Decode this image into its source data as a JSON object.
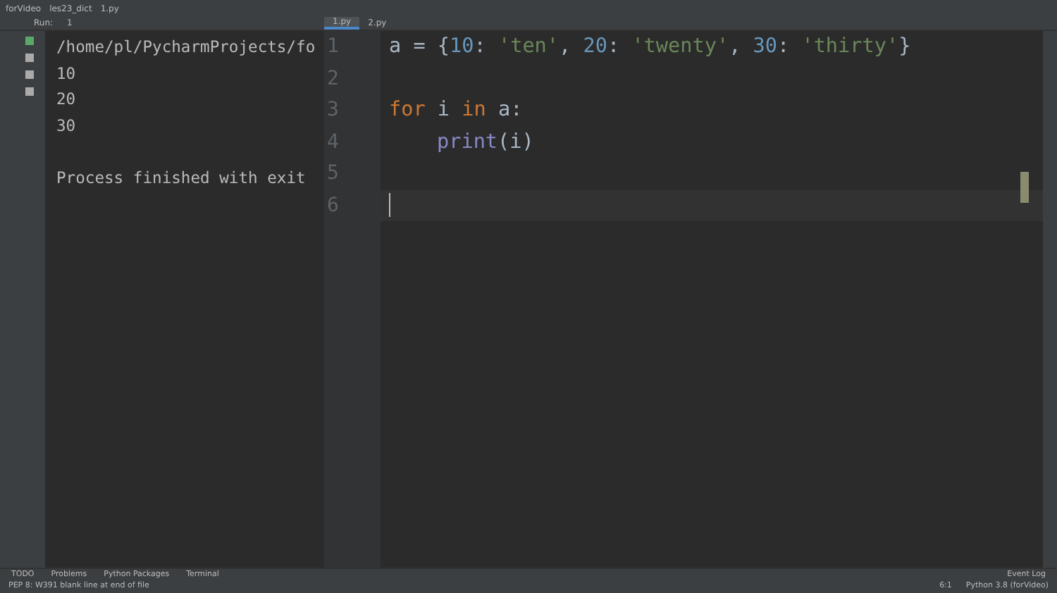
{
  "breadcrumb": [
    "forVideo",
    "les23_dict",
    "1.py"
  ],
  "run_panel": {
    "label": "Run:",
    "tab": "1"
  },
  "editor_tabs": [
    {
      "label": "1.py",
      "selected": true
    },
    {
      "label": "2.py",
      "selected": false
    }
  ],
  "console": {
    "lines": [
      "/home/pl/PycharmProjects/fo",
      "10",
      "20",
      "30"
    ],
    "exit_message": "Process finished with exit"
  },
  "editor": {
    "lines": [
      {
        "number": "1",
        "current": false,
        "tokens": [
          {
            "text": "a = {",
            "kind": "plain"
          },
          {
            "text": "10",
            "kind": "number"
          },
          {
            "text": ": ",
            "kind": "plain"
          },
          {
            "text": "'ten'",
            "kind": "string"
          },
          {
            "text": ", ",
            "kind": "plain"
          },
          {
            "text": "20",
            "kind": "number"
          },
          {
            "text": ": ",
            "kind": "plain"
          },
          {
            "text": "'twenty'",
            "kind": "string"
          },
          {
            "text": ", ",
            "kind": "plain"
          },
          {
            "text": "30",
            "kind": "number"
          },
          {
            "text": ": ",
            "kind": "plain"
          },
          {
            "text": "'thirty'",
            "kind": "string"
          },
          {
            "text": "}",
            "kind": "plain"
          }
        ]
      },
      {
        "number": "2",
        "current": false
      },
      {
        "number": "3",
        "current": false,
        "tokens": [
          {
            "text": "for",
            "kind": "keyword"
          },
          {
            "text": " i ",
            "kind": "plain"
          },
          {
            "text": "in",
            "kind": "keyword"
          },
          {
            "text": " a:",
            "kind": "plain"
          }
        ]
      },
      {
        "number": "4",
        "current": false,
        "indented": true,
        "tokens": [
          {
            "text": "print",
            "kind": "builtin"
          },
          {
            "text": "(i)",
            "kind": "plain"
          }
        ]
      },
      {
        "number": "5",
        "current": false
      },
      {
        "number": "6",
        "current": true
      }
    ]
  },
  "tool_tabs": [
    "TODO",
    "Problems",
    "Python Packages",
    "Terminal"
  ],
  "event_log": "Event Log",
  "status": {
    "message": "PEP 8: W391 blank line at end of file",
    "position": "6:1",
    "interpreter": "Python 3.8 (forVideo)"
  }
}
